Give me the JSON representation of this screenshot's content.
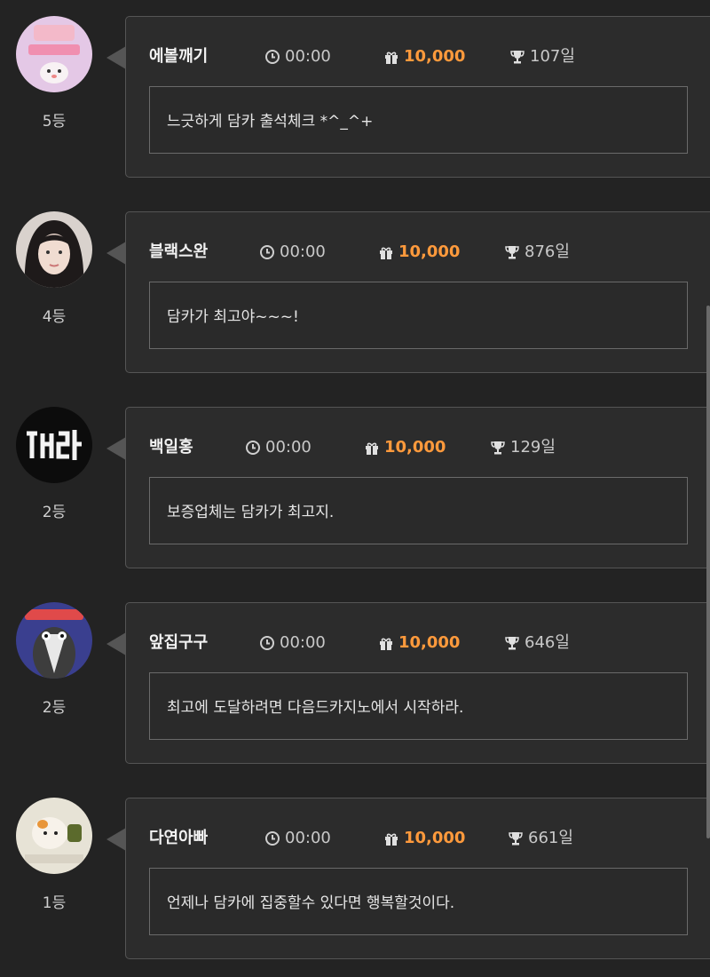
{
  "entries": [
    {
      "nickname": "에볼깨기",
      "time": "00:00",
      "points": "10,000",
      "days": "107일",
      "message": "느긋하게 담카 출석체크 *^_^+",
      "rank": "5등",
      "avatar": "avatar-cat-sticker"
    },
    {
      "nickname": "블랙스완",
      "time": "00:00",
      "points": "10,000",
      "days": "876일",
      "message": "담카가 최고야~~~!",
      "rank": "4등",
      "avatar": "avatar-portrait"
    },
    {
      "nickname": "백일홍",
      "time": "00:00",
      "points": "10,000",
      "days": "129일",
      "message": "보증업체는 담카가 최고지.",
      "rank": "2등",
      "avatar": "avatar-neon-sign"
    },
    {
      "nickname": "앞집구구",
      "time": "00:00",
      "points": "10,000",
      "days": "646일",
      "message": "최고에 도달하려면 다음드카지노에서 시작하라.",
      "rank": "2등",
      "avatar": "avatar-cartoon-bird"
    },
    {
      "nickname": "다연아빠",
      "time": "00:00",
      "points": "10,000",
      "days": "661일",
      "message": "언제나 담카에 집중할수 있다면 행복할것이다.",
      "rank": "1등",
      "avatar": "avatar-hamster-sticker"
    }
  ],
  "colors": {
    "background": "#232323",
    "card": "#2c2c2c",
    "border": "#555555",
    "accent": "#ff9a3c"
  },
  "icons": {
    "time": "clock-icon",
    "points": "gift-icon",
    "days": "trophy-icon"
  }
}
